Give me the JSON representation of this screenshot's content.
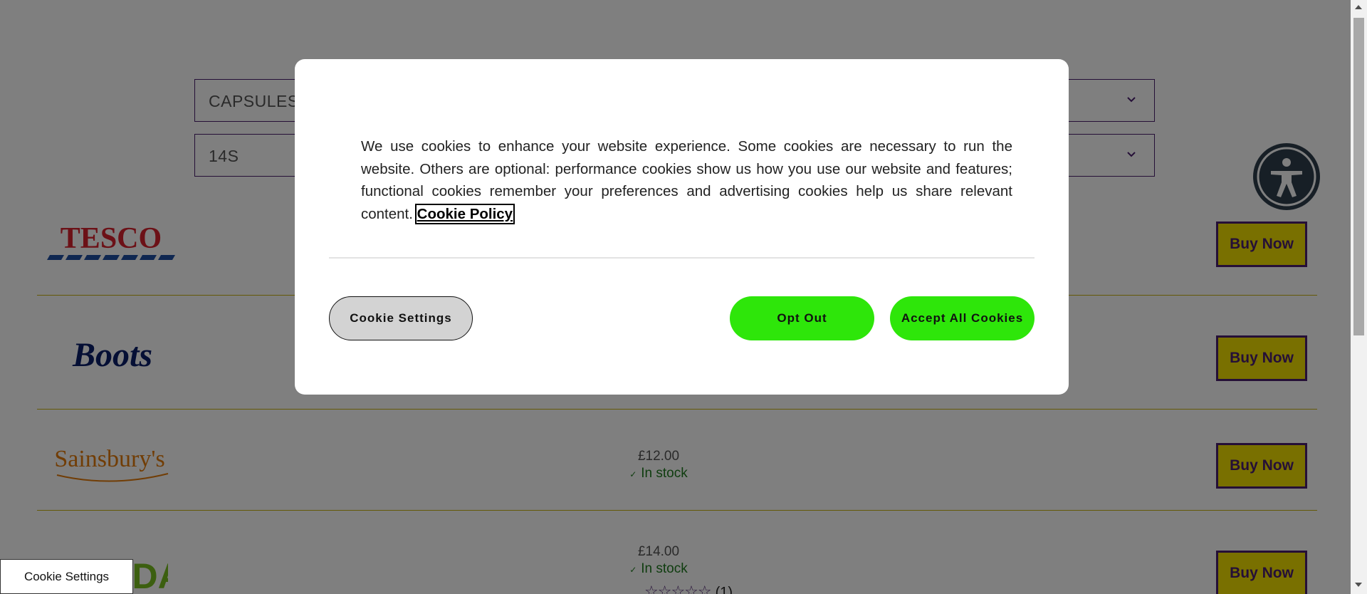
{
  "filters": {
    "format_value": "CAPSULES",
    "size_value": "14S"
  },
  "retailers": [
    {
      "name": "TESCO",
      "price": "",
      "stock": "",
      "buy_label": "Buy Now"
    },
    {
      "name": "Boots",
      "price": "",
      "stock": "",
      "buy_label": "Buy Now"
    },
    {
      "name": "Sainsbury's",
      "price": "£12.00",
      "stock": "In stock",
      "buy_label": "Buy Now"
    },
    {
      "name": "ASDA",
      "price": "£14.00",
      "stock": "In stock",
      "buy_label": "Buy Now",
      "rating_count": "(1)"
    }
  ],
  "stock_tick": "✓",
  "stars_glyphs": "☆☆☆☆☆",
  "cookie_modal": {
    "text": "We use cookies to enhance your website experience. Some cookies are necessary to run the website. Others are optional: performance cookies show us how you use our website and features; functional cookies remember your preferences and advertising cookies help us share relevant content.",
    "policy_link": "Cookie Policy",
    "settings_label": "Cookie Settings",
    "optout_label": "Opt Out",
    "accept_label": "Accept All Cookies"
  },
  "cookie_tab_label": "Cookie Settings",
  "colors": {
    "brand_purple": "#4b1f6f",
    "buy_yellow": "#f2e100",
    "consent_green": "#2ee60a",
    "stock_green": "#1f7a1f",
    "tesco_red": "#d9232e",
    "tesco_blue": "#1f4fa3",
    "boots_navy": "#0b1f6b",
    "sainsburys_orange": "#e37b0b",
    "asda_green": "#78be20"
  },
  "icons": {
    "dropdown": "chevron-down-icon",
    "accessibility": "accessibility-icon",
    "stock": "check-icon",
    "rating": "star-outline-icon"
  }
}
